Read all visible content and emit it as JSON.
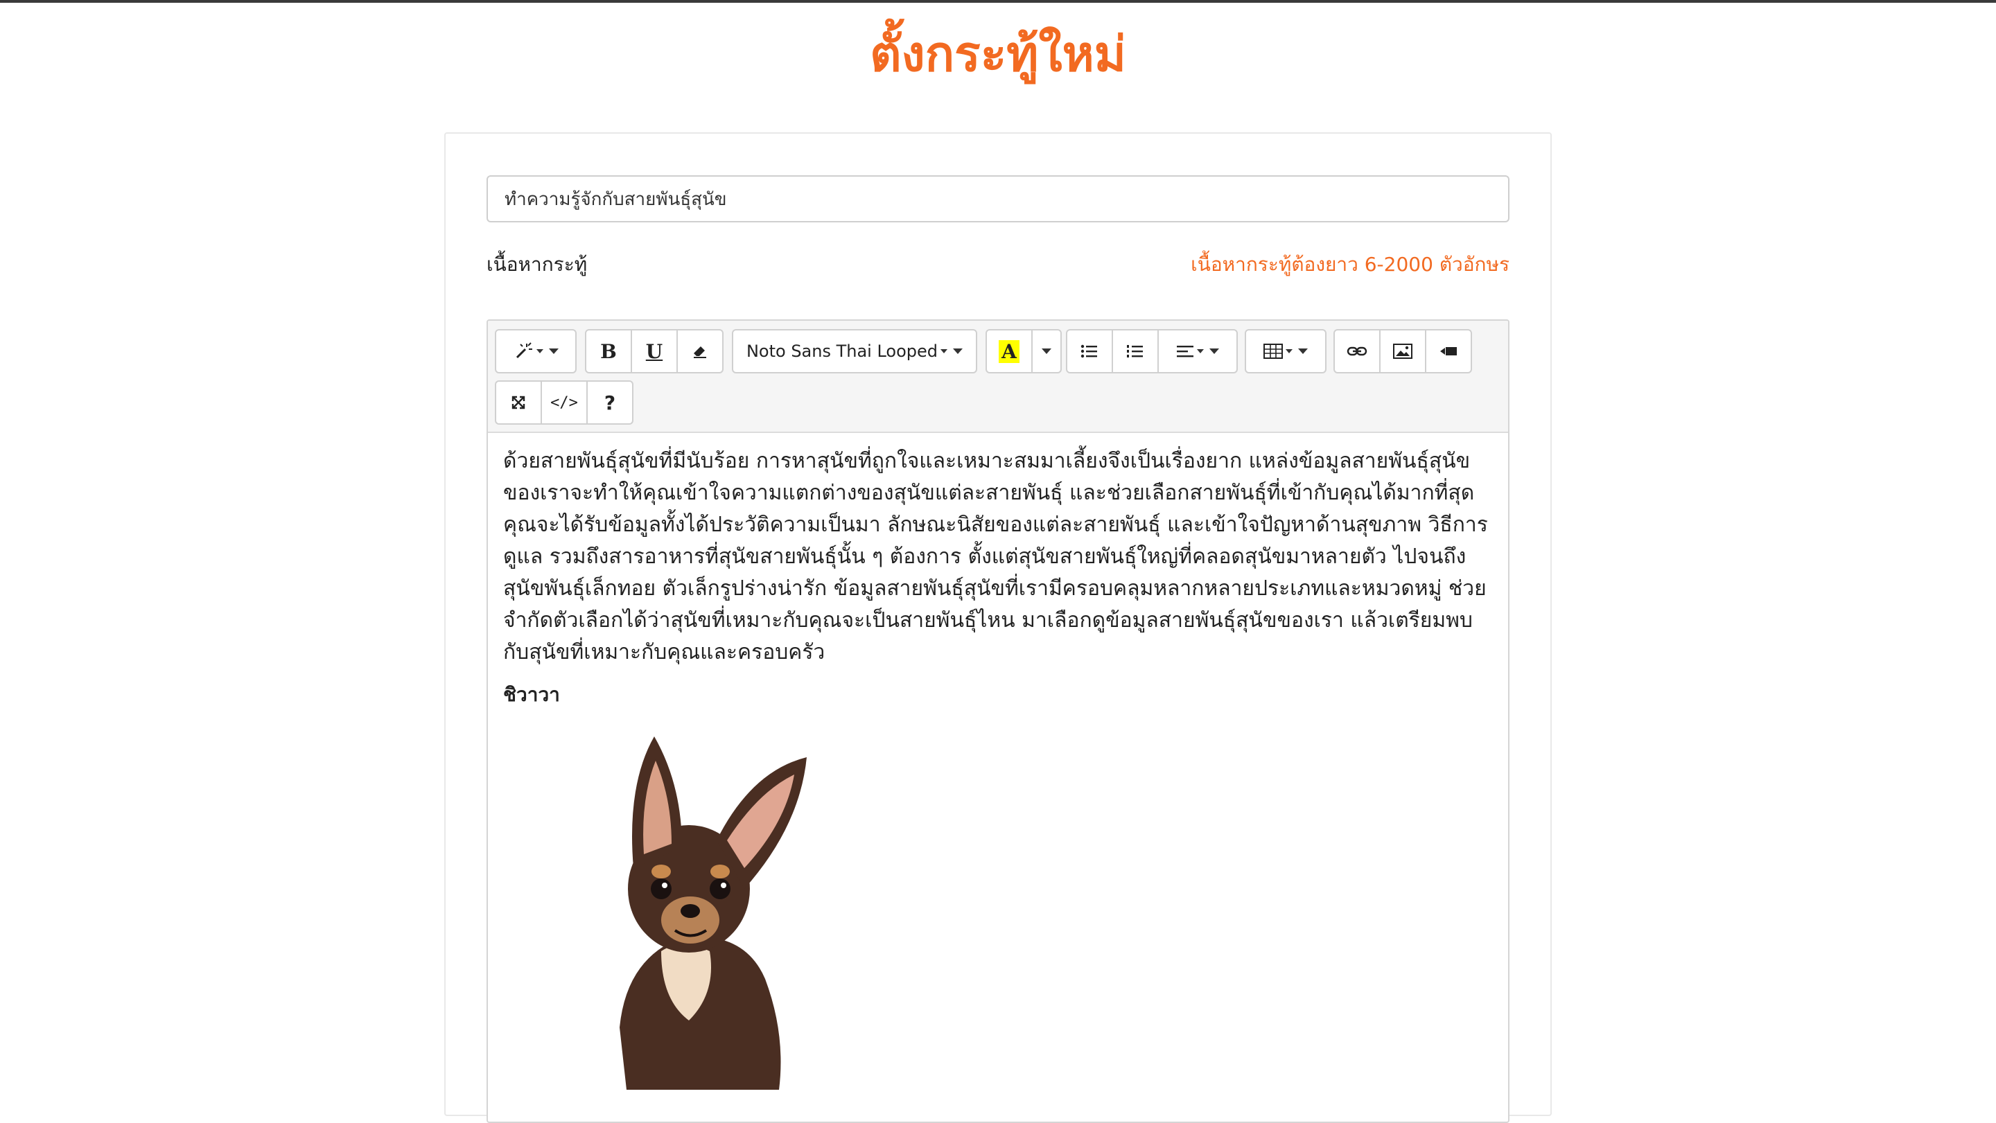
{
  "page": {
    "title": "ตั้งกระทู้ใหม่"
  },
  "form": {
    "title_value": "ทำความรู้จักกับสายพันธุ์สุนัข",
    "content_label": "เนื้อหากระทู้",
    "length_hint": "เนื้อหากระทู้ต้องยาว 6-2000 ตัวอักษร"
  },
  "toolbar": {
    "style_icon": "magic-wand-icon",
    "bold_label": "B",
    "underline_label": "U",
    "eraser_icon": "eraser-icon",
    "font_name": "Noto Sans Thai Looped",
    "color_label": "A",
    "color_highlight": "#ffff00",
    "ul_icon": "unordered-list-icon",
    "ol_icon": "ordered-list-icon",
    "align_icon": "align-icon",
    "table_icon": "table-icon",
    "link_icon": "link-icon",
    "picture_icon": "picture-icon",
    "video_icon": "video-icon",
    "fullscreen_icon": "fullscreen-icon",
    "codeview_label": "</>",
    "help_label": "?"
  },
  "content": {
    "paragraph": "ด้วยสายพันธุ์สุนัขที่มีนับร้อย การหาสุนัขที่ถูกใจและเหมาะสมมาเลี้ยงจึงเป็นเรื่องยาก แหล่งข้อมูลสายพันธุ์สุนัขของเราจะทำให้คุณเข้าใจความแตกต่างของสุนัขแต่ละสายพันธุ์ และช่วยเลือกสายพันธุ์ที่เข้ากับคุณได้มากที่สุด คุณจะได้รับข้อมูลทั้งได้ประวัติความเป็นมา ลักษณะนิสัยของแต่ละสายพันธุ์ และเข้าใจปัญหาด้านสุขภาพ วิธีการดูแล รวมถึงสารอาหารที่สุนัขสายพันธุ์นั้น ๆ ต้องการ ตั้งแต่สุนัขสายพันธุ์ใหญ่ที่คลอดสุนัขมาหลายตัว ไปจนถึงสุนัขพันธุ์เล็กทอย ตัวเล็กรูปร่างน่ารัก ข้อมูลสายพันธุ์สุนัขที่เรามีครอบคลุมหลากหลายประเภทและหมวดหมู่ ช่วยจำกัดตัวเลือกได้ว่าสุนัขที่เหมาะกับคุณจะเป็นสายพันธุ์ไหน มาเลือกดูข้อมูลสายพันธุ์สุนัขของเรา แล้วเตรียมพบกับสุนัขที่เหมาะกับคุณและครอบครัว",
    "breed_heading": "ชิวาวา"
  },
  "colors": {
    "accent": "#f26a21"
  }
}
